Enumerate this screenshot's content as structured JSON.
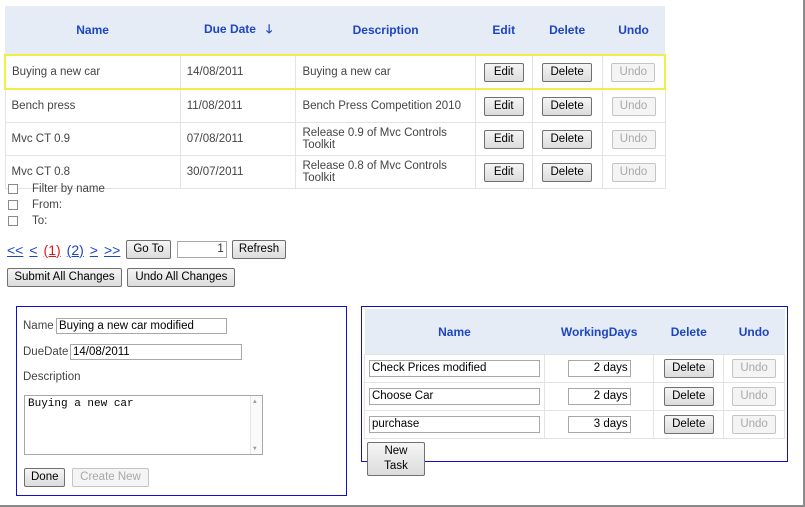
{
  "main_table": {
    "headers": {
      "name": "Name",
      "due_date": "Due Date",
      "description": "Description",
      "edit": "Edit",
      "delete": "Delete",
      "undo": "Undo"
    },
    "rows": [
      {
        "name": "Buying a new car",
        "due_date": "14/08/2011",
        "description": "Buying a new car",
        "edit": "Edit",
        "delete": "Delete",
        "undo": "Undo"
      },
      {
        "name": "Bench press",
        "due_date": "11/08/2011",
        "description": "Bench Press Competition 2010",
        "edit": "Edit",
        "delete": "Delete",
        "undo": "Undo"
      },
      {
        "name": "Mvc CT 0.9",
        "due_date": "07/08/2011",
        "description": "Release  0.9 of Mvc Controls Toolkit",
        "edit": "Edit",
        "delete": "Delete",
        "undo": "Undo"
      },
      {
        "name": "Mvc CT 0.8",
        "due_date": "30/07/2011",
        "description": "Release  0.8 of Mvc Controls Toolkit",
        "edit": "Edit",
        "delete": "Delete",
        "undo": "Undo"
      }
    ]
  },
  "filters": {
    "by_name": "Filter by name",
    "from": "From:",
    "to": "To:"
  },
  "pager": {
    "first": "<<",
    "prev": "<",
    "page1": "(1)",
    "page2": "(2)",
    "next": ">",
    "last": ">>",
    "goto_label": "Go To",
    "goto_value": "1",
    "refresh": "Refresh"
  },
  "actions": {
    "submit_all": "Submit All Changes",
    "undo_all": "Undo All Changes"
  },
  "detail": {
    "name_label": "Name",
    "name_value": "Buying a new car modified",
    "due_label": "DueDate",
    "due_value": "14/08/2011",
    "desc_label": "Description",
    "desc_value": "Buying a new car",
    "done": "Done",
    "create_new": "Create New"
  },
  "tasks": {
    "headers": {
      "name": "Name",
      "working_days": "WorkingDays",
      "delete": "Delete",
      "undo": "Undo"
    },
    "rows": [
      {
        "name": "Check Prices modified",
        "days": "2 days",
        "delete": "Delete",
        "undo": "Undo"
      },
      {
        "name": "Choose Car",
        "days": "2 days",
        "delete": "Delete",
        "undo": "Undo"
      },
      {
        "name": "purchase",
        "days": "3 days",
        "delete": "Delete",
        "undo": "Undo"
      }
    ],
    "new_task": "New Task"
  },
  "colors": {
    "header_bg": "#e6ecf5",
    "header_text": "#1d45c4",
    "selected_border": "#f0ef46",
    "panel_border": "#1010c8",
    "current_page": "#e01818"
  },
  "icons": {
    "sort": "arrow-down-icon"
  }
}
